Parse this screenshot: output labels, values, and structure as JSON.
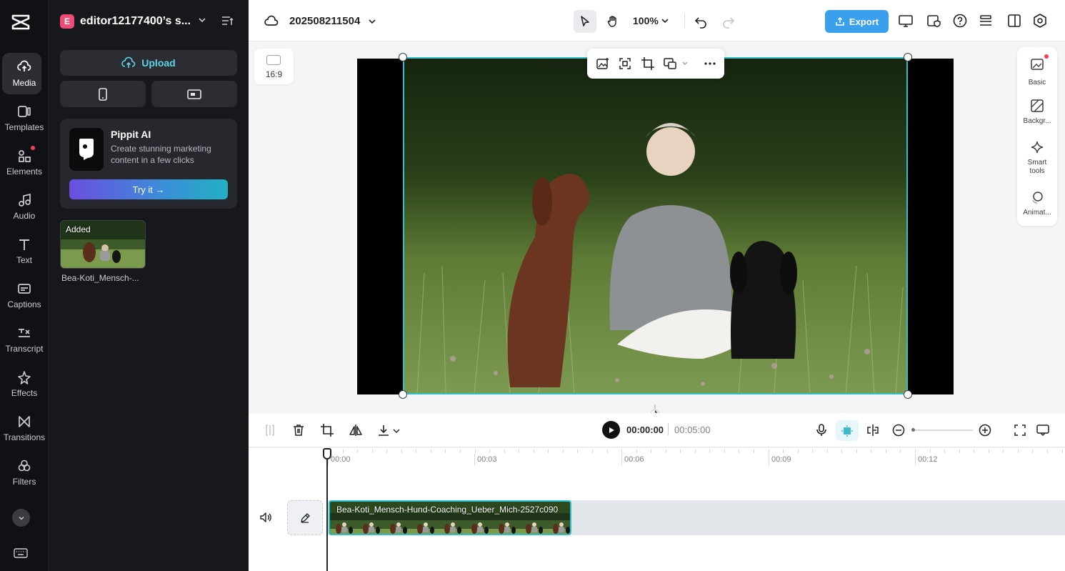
{
  "rail": {
    "items": [
      {
        "label": "Media",
        "icon": "cloud-upload-icon"
      },
      {
        "label": "Templates",
        "icon": "templates-icon"
      },
      {
        "label": "Elements",
        "icon": "elements-icon"
      },
      {
        "label": "Audio",
        "icon": "music-note-icon"
      },
      {
        "label": "Text",
        "icon": "text-icon"
      },
      {
        "label": "Captions",
        "icon": "captions-icon"
      },
      {
        "label": "Transcript",
        "icon": "transcript-icon"
      },
      {
        "label": "Effects",
        "icon": "effects-star-icon"
      },
      {
        "label": "Transitions",
        "icon": "transitions-icon"
      },
      {
        "label": "Filters",
        "icon": "filters-icon"
      }
    ]
  },
  "panel": {
    "workspace_badge": "E",
    "workspace_name": "editor12177400’s s...",
    "upload_label": "Upload",
    "pippit": {
      "title": "Pippit AI",
      "description": "Create stunning marketing content in a few clicks",
      "button": "Try it →"
    },
    "media": [
      {
        "badge": "Added",
        "name": "Bea-Koti_Mensch-..."
      }
    ]
  },
  "topbar": {
    "project_title": "202508211504",
    "zoom": "100%",
    "export_label": "Export"
  },
  "canvas": {
    "aspect_ratio": "16:9"
  },
  "right_panel": {
    "items": [
      "Basic",
      "Backgr...",
      "Smart tools",
      "Animat..."
    ]
  },
  "playback": {
    "current_time": "00:00:00",
    "total_time": "00:05:00"
  },
  "timeline": {
    "ruler_labels": [
      "00:00",
      "00:03",
      "00:06",
      "00:09",
      "00:12"
    ],
    "clip_name": "Bea-Koti_Mensch-Hund-Coaching_Ueber_Mich-2527c090"
  },
  "colors": {
    "accent": "#2ec0cf",
    "export": "#3a9fec",
    "rail_bg": "#101114",
    "panel_bg": "#17181c"
  }
}
